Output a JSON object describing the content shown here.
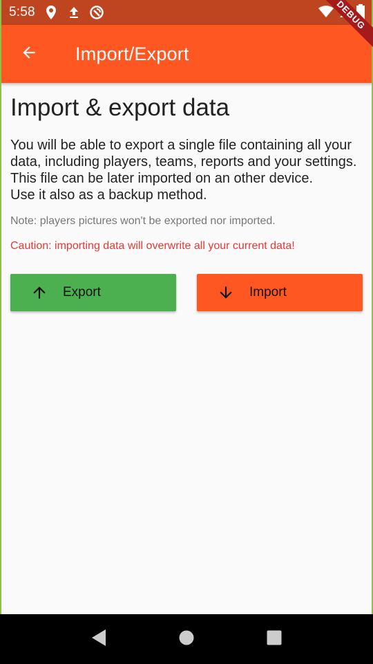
{
  "status_bar": {
    "time": "5:58",
    "icons": [
      "location-icon",
      "upload-icon",
      "no-disturb-icon"
    ],
    "right_icons": [
      "wifi-icon",
      "signal-icon",
      "battery-icon"
    ]
  },
  "debug_banner": "DEBUG",
  "app_bar": {
    "title": "Import/Export",
    "back_icon": "arrow-back-icon",
    "background": "#ff5722"
  },
  "main": {
    "heading": "Import & export data",
    "description": "You will be able to export a single file containing all your data, including players, teams, reports and your settings.\nThis file can be later imported on an other device.\nUse it also as a backup method.",
    "note": "Note: players pictures won't be exported nor imported.",
    "caution": "Caution: importing data will overwrite all your current data!"
  },
  "buttons": {
    "export_label": "Export",
    "export_icon": "arrow-up-icon",
    "export_color": "#4caf50",
    "import_label": "Import",
    "import_icon": "arrow-down-icon",
    "import_color": "#ff5722"
  },
  "nav_bar": {
    "items": [
      "back-triangle-icon",
      "home-circle-icon",
      "recents-square-icon"
    ]
  }
}
